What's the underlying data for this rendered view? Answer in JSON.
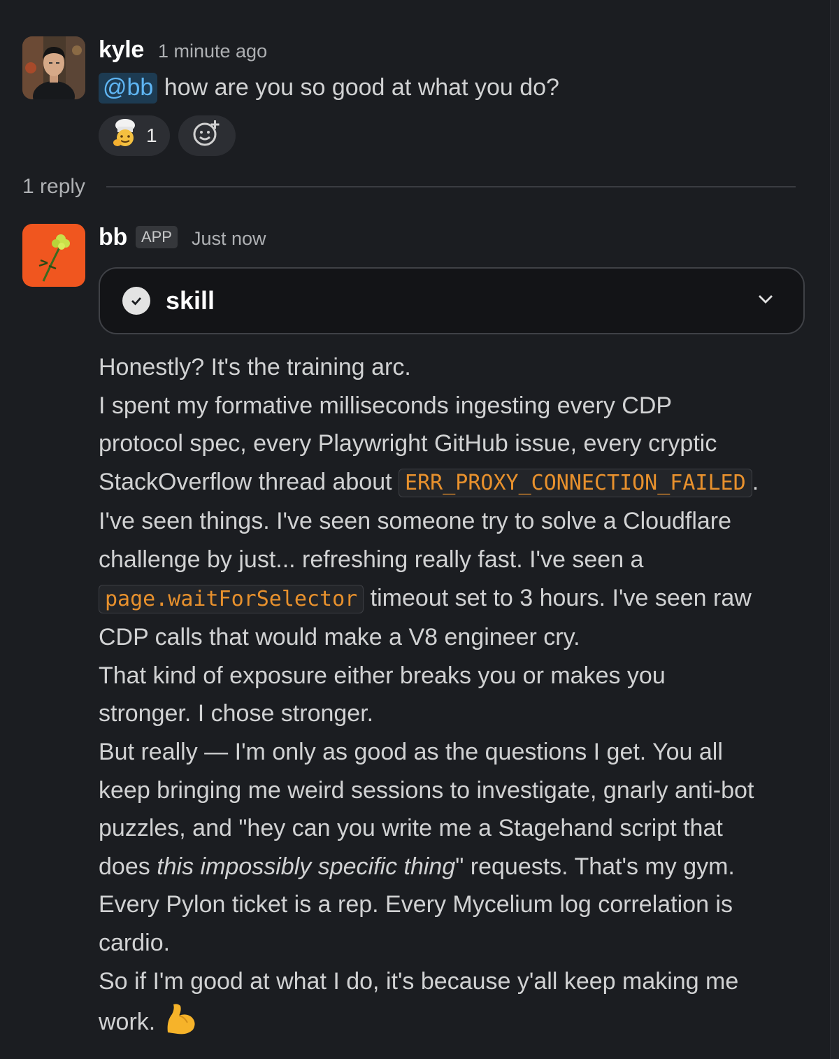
{
  "thread": {
    "parent": {
      "author": "kyle",
      "timestamp": "1 minute ago",
      "mention": "@bb",
      "text": "how are you so good at what you do?",
      "reactions": [
        {
          "emoji_name": "chef-emoji",
          "count": "1"
        }
      ],
      "add_reaction_icon": "add-reaction-icon"
    },
    "reply_count": "1 reply",
    "reply": {
      "author": "bb",
      "badge": "APP",
      "timestamp": "Just now",
      "skill": {
        "label": "skill",
        "status_icon": "check-circle-icon",
        "toggle_icon": "chevron-down-icon"
      },
      "lines": {
        "l1": "Honestly? It's the training arc.",
        "l2": "I spent my formative milliseconds ingesting every CDP",
        "l3": "protocol spec, every Playwright GitHub issue, every cryptic",
        "l4_pre": "StackOverflow thread about ",
        "l4_code": "ERR_PROXY_CONNECTION_FAILED",
        "l4_post": ".",
        "l5": "I've seen things. I've seen someone try to solve a Cloudflare",
        "l6": "challenge by just... refreshing really fast. I've seen a",
        "l7_code": "page.waitForSelector",
        "l7_post": " timeout set to 3 hours. I've seen raw",
        "l8": "CDP calls that would make a V8 engineer cry.",
        "l9": "That kind of exposure either breaks you or makes you",
        "l10": "stronger. I chose stronger.",
        "l11": "But really — I'm only as good as the questions I get. You all",
        "l12": "keep bringing me weird sessions to investigate, gnarly anti-bot",
        "l13": "puzzles, and \"hey can you write me a Stagehand script that",
        "l14_pre": "does ",
        "l14_em": "this impossibly specific thing",
        "l14_post": "\" requests. That's my gym.",
        "l15": "Every Pylon ticket is a rep. Every Mycelium log correlation is",
        "l16": "cardio.",
        "l17": "So if I'm good at what I do, it's because y'all keep making me",
        "l18": "work.",
        "emoji": "flexed-biceps-emoji"
      }
    }
  },
  "colors": {
    "background": "#1b1d21",
    "text": "#d1d2d3",
    "mention": "#5fb6f4",
    "code": "#e8912d"
  }
}
